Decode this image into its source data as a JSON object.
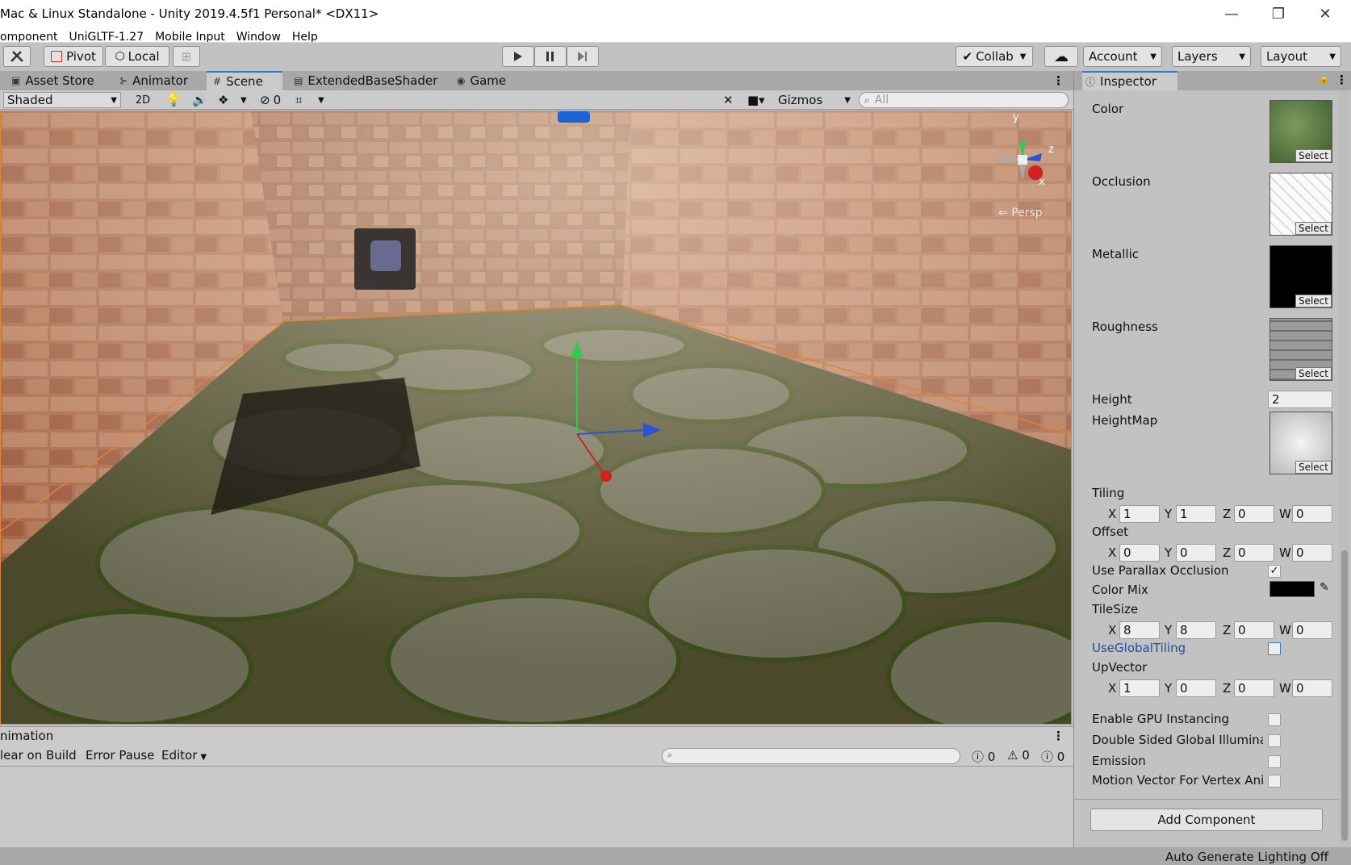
{
  "window": {
    "title": "Mac & Linux Standalone - Unity 2019.4.5f1 Personal* <DX11>",
    "minimize": "—",
    "maximize": "❐",
    "close": "✕"
  },
  "menu": [
    "omponent",
    "UniGLTF-1.27",
    "Mobile Input",
    "Window",
    "Help"
  ],
  "toolbar": {
    "pivot": "Pivot",
    "local": "Local",
    "collab": "Collab",
    "account": "Account",
    "layers": "Layers",
    "layout": "Layout"
  },
  "tabs": [
    "Asset Store",
    "Animator",
    "Scene",
    "ExtendedBaseShader",
    "Game"
  ],
  "active_tab": "Scene",
  "scene_bar": {
    "shading": "Shaded",
    "mode_2d": "2D",
    "hidden_count": "0",
    "gizmos": "Gizmos",
    "search_placeholder": "All"
  },
  "viewport": {
    "axis_y": "y",
    "axis_z": "z",
    "axis_x": "x",
    "projection": "Persp"
  },
  "animation_panel": {
    "title": "nimation",
    "clear_on_build": "lear on Build",
    "error_pause": "Error Pause",
    "editor": "Editor",
    "errors": "0",
    "warnings": "0",
    "messages": "0"
  },
  "inspector": {
    "tab": "Inspector",
    "select": "Select",
    "textures": [
      "Color",
      "Occlusion",
      "Metallic",
      "Roughness",
      "HeightMap"
    ],
    "height_label": "Height",
    "height_value": "2",
    "tiling": {
      "label": "Tiling",
      "x": "1",
      "y": "1",
      "z": "0",
      "w": "0"
    },
    "offset": {
      "label": "Offset",
      "x": "0",
      "y": "0",
      "z": "0",
      "w": "0"
    },
    "use_parallax": "Use Parallax Occlusion",
    "color_mix": "Color Mix",
    "tilesize": {
      "label": "TileSize",
      "x": "8",
      "y": "8",
      "z": "0",
      "w": "0"
    },
    "use_global_tiling": "UseGlobalTiling",
    "upvector": {
      "label": "UpVector",
      "x": "1",
      "y": "0",
      "z": "0",
      "w": "0"
    },
    "gpu_instancing": "Enable GPU Instancing",
    "double_sided_gi": "Double Sided Global Illuminati",
    "emission": "Emission",
    "motion_vector": "Motion Vector For Vertex Anim",
    "add_component": "Add Component",
    "axis_x": "X",
    "axis_y": "Y",
    "axis_z": "Z",
    "axis_w": "W"
  },
  "status": "Auto Generate Lighting Off",
  "colors": {
    "accent": "#2e7bdd",
    "selection_outline": "#e0843c",
    "link_blue": "#1d4fa0"
  }
}
